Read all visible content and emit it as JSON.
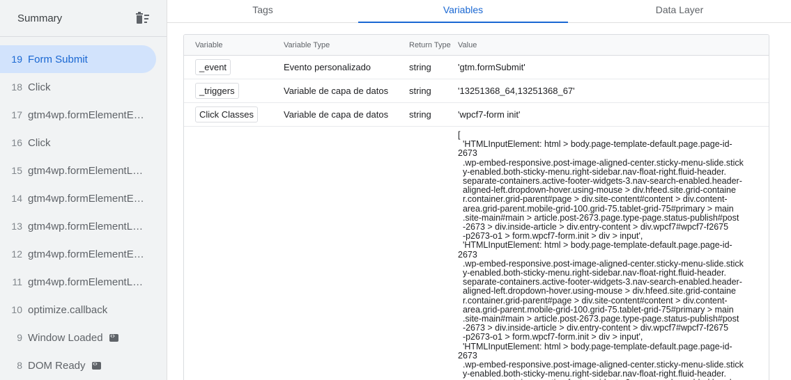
{
  "sidebar": {
    "title": "Summary",
    "items": [
      {
        "num": "19",
        "label": "Form Submit",
        "active": true,
        "badge": false
      },
      {
        "num": "18",
        "label": "Click",
        "active": false,
        "badge": false
      },
      {
        "num": "17",
        "label": "gtm4wp.formElementEn...",
        "active": false,
        "badge": false
      },
      {
        "num": "16",
        "label": "Click",
        "active": false,
        "badge": false
      },
      {
        "num": "15",
        "label": "gtm4wp.formElementLe...",
        "active": false,
        "badge": false
      },
      {
        "num": "14",
        "label": "gtm4wp.formElementEn...",
        "active": false,
        "badge": false
      },
      {
        "num": "13",
        "label": "gtm4wp.formElementLe...",
        "active": false,
        "badge": false
      },
      {
        "num": "12",
        "label": "gtm4wp.formElementEn...",
        "active": false,
        "badge": false
      },
      {
        "num": "11",
        "label": "gtm4wp.formElementLe...",
        "active": false,
        "badge": false
      },
      {
        "num": "10",
        "label": "optimize.callback",
        "active": false,
        "badge": false
      },
      {
        "num": "9",
        "label": "Window Loaded",
        "active": false,
        "badge": true
      },
      {
        "num": "8",
        "label": "DOM Ready",
        "active": false,
        "badge": true
      }
    ]
  },
  "tabs": [
    {
      "label": "Tags",
      "active": false
    },
    {
      "label": "Variables",
      "active": true
    },
    {
      "label": "Data Layer",
      "active": false
    }
  ],
  "table": {
    "headers": {
      "variable": "Variable",
      "type": "Variable Type",
      "return": "Return Type",
      "value": "Value"
    },
    "rows": [
      {
        "variable": "_event",
        "type": "Evento personalizado",
        "return": "string",
        "value": "'gtm.formSubmit'"
      },
      {
        "variable": "_triggers",
        "type": "Variable de capa de datos",
        "return": "string",
        "value": "'13251368_64,13251368_67'"
      },
      {
        "variable": "Click Classes",
        "type": "Variable de capa de datos",
        "return": "string",
        "value": "'wpcf7-form init'"
      }
    ],
    "long_value": "[\n  'HTMLInputElement: html > body.page-template-default.page.page-id-\n2673\n  .wp-embed-responsive.post-image-aligned-center.sticky-menu-slide.stick\n  y-enabled.both-sticky-menu.right-sidebar.nav-float-right.fluid-header.\n  separate-containers.active-footer-widgets-3.nav-search-enabled.header-\n  aligned-left.dropdown-hover.using-mouse > div.hfeed.site.grid-containe\n  r.container.grid-parent#page > div.site-content#content > div.content-\n  area.grid-parent.mobile-grid-100.grid-75.tablet-grid-75#primary > main\n  .site-main#main > article.post-2673.page.type-page.status-publish#post\n  -2673 > div.inside-article > div.entry-content > div.wpcf7#wpcf7-f2675\n  -p2673-o1 > form.wpcf7-form.init > div > input',\n  'HTMLInputElement: html > body.page-template-default.page.page-id-\n2673\n  .wp-embed-responsive.post-image-aligned-center.sticky-menu-slide.stick\n  y-enabled.both-sticky-menu.right-sidebar.nav-float-right.fluid-header.\n  separate-containers.active-footer-widgets-3.nav-search-enabled.header-\n  aligned-left.dropdown-hover.using-mouse > div.hfeed.site.grid-containe\n  r.container.grid-parent#page > div.site-content#content > div.content-\n  area.grid-parent.mobile-grid-100.grid-75.tablet-grid-75#primary > main\n  .site-main#main > article.post-2673.page.type-page.status-publish#post\n  -2673 > div.inside-article > div.entry-content > div.wpcf7#wpcf7-f2675\n  -p2673-o1 > form.wpcf7-form.init > div > input',\n  'HTMLInputElement: html > body.page-template-default.page.page-id-\n2673\n  .wp-embed-responsive.post-image-aligned-center.sticky-menu-slide.stick\n  y-enabled.both-sticky-menu.right-sidebar.nav-float-right.fluid-header.\n  separate-containers.active-footer-widgets-3.nav-search-enabled.header-"
  },
  "icons": {
    "delete": "delete-sweep-icon",
    "code": "code-icon"
  },
  "colors": {
    "accent": "#1967d2",
    "active_bg": "#d2e3fc",
    "sidebar_bg": "#f1f3f4"
  }
}
